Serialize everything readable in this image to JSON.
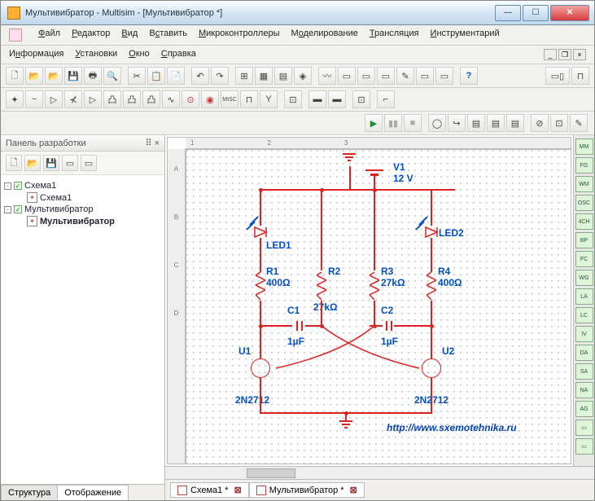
{
  "window": {
    "title": "Мультивибратор - Multisim - [Мультивибратор *]"
  },
  "menu": {
    "file": "Файл",
    "edit": "Редактор",
    "view": "Вид",
    "place": "Вставить",
    "mcu": "Микроконтроллеры",
    "sim": "Моделирование",
    "transfer": "Трансляция",
    "instruments": "Инструментарий",
    "info": "Информация",
    "settings": "Установки",
    "window": "Окно",
    "help": "Справка"
  },
  "panel": {
    "title": "Панель разработки"
  },
  "tree": {
    "d1": "Схема1",
    "d1s": "Схема1",
    "d2": "Мультивибратор",
    "d2s": "Мультивибратор"
  },
  "ltabs": {
    "struct": "Структура",
    "view": "Отображение"
  },
  "schem": {
    "v1": "V1",
    "v1v": "12 V",
    "led1": "LED1",
    "led2": "LED2",
    "r1": "R1",
    "r1v": "400Ω",
    "r2": "R2",
    "r2v": "27kΩ",
    "r3": "R3",
    "r3v": "27kΩ",
    "r4": "R4",
    "r4v": "400Ω",
    "c1": "C1",
    "c1v": "1µF",
    "c2": "C2",
    "c2v": "1µF",
    "u1": "U1",
    "u2": "U2",
    "q": "2N2712",
    "url": "http://www.sxemotehnika.ru"
  },
  "tabs": {
    "t1": "Схема1 *",
    "t2": "Мультивибратор *"
  },
  "ruler": {
    "h": [
      "1",
      "2",
      "3"
    ],
    "v": [
      "A",
      "B",
      "C",
      "D"
    ]
  }
}
